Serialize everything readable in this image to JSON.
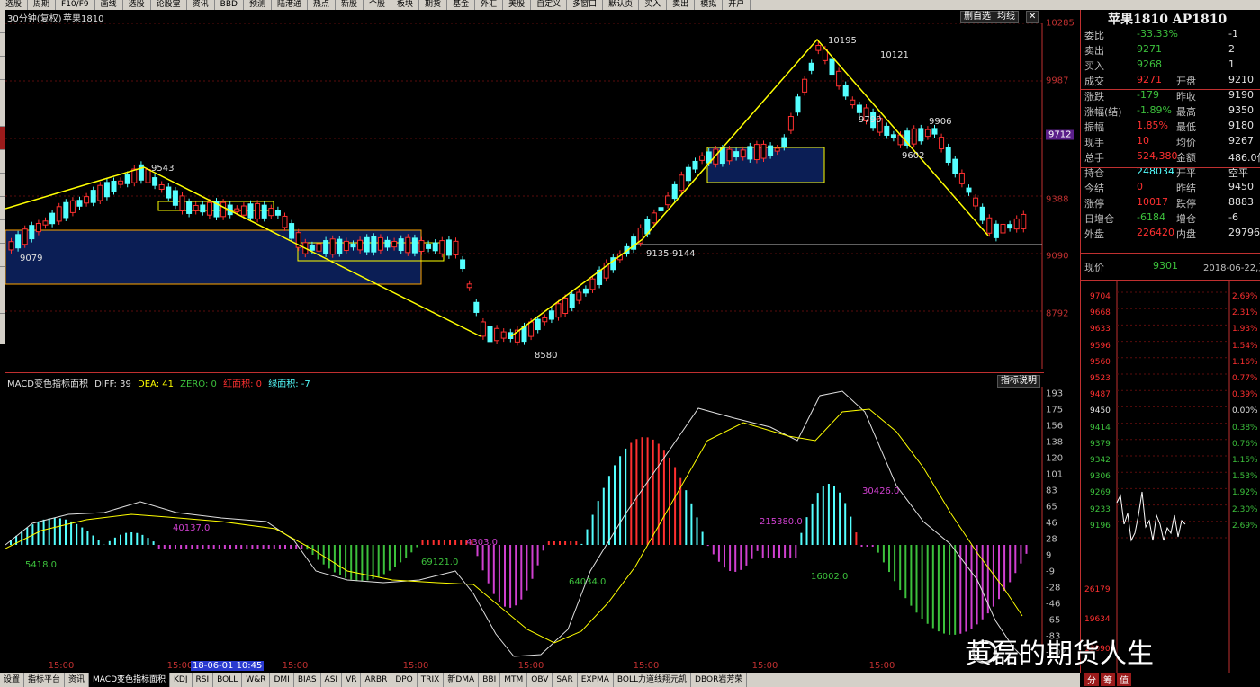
{
  "toolbar": {
    "items": [
      "选股",
      "周期",
      "F10/F9",
      "画线",
      "选股",
      "论股堂",
      "资讯",
      "BBD",
      "预测",
      "陆港通",
      "热点",
      "新股",
      "个股",
      "板块",
      "期货",
      "基金",
      "外汇",
      "美股",
      "自定义",
      "多窗口",
      "默认页",
      "买入",
      "卖出",
      "模拟",
      "开户"
    ]
  },
  "chart_header": {
    "period": "30分钟(复权)",
    "symbol": "苹果1810",
    "btn_delete": "删自选",
    "btn_avg": "均线"
  },
  "price_axis": {
    "ticks": [
      "10285",
      "9987",
      "9712",
      "9388",
      "9090",
      "8792"
    ],
    "current": "9712"
  },
  "annotations": {
    "high1": "9543",
    "low1": "9079",
    "low2": "8580",
    "high2": "10195",
    "high3": "10121",
    "mid1": "9790",
    "mid2": "9602",
    "mid3": "9906",
    "range": "9135-9144"
  },
  "macd_header": {
    "name": "MACD变色指标面积",
    "diff": "DIFF: 39",
    "dea": "DEA: 41",
    "zero": "ZERO: 0",
    "red_area": "红面积: 0",
    "green_area": "绿面积: -7",
    "explain": "指标说明"
  },
  "macd_axis": {
    "ticks": [
      "193",
      "175",
      "156",
      "138",
      "120",
      "101",
      "83",
      "65",
      "46",
      "28",
      "9",
      "-9",
      "-28",
      "-46",
      "-65",
      "-83",
      "-102"
    ]
  },
  "macd_labels": [
    "5418.0",
    "40137.0",
    "69121.0",
    "4303.0",
    "64034.0",
    "215380.0",
    "16002.0",
    "30426.0"
  ],
  "time_axis": {
    "labels": [
      "15:00",
      "15:00",
      "15:00",
      "15:00",
      "15:00",
      "15:00",
      "15:00",
      "15:00"
    ],
    "date_flag": "18-06-01 10:45"
  },
  "bottom_tabs": [
    "设置",
    "指标平台",
    "资讯",
    "MACD变色指标面积",
    "KDJ",
    "RSI",
    "BOLL",
    "W&R",
    "DMI",
    "BIAS",
    "ASI",
    "VR",
    "ARBR",
    "DPO",
    "TRIX",
    "新DMA",
    "BBI",
    "MTM",
    "OBV",
    "SAR",
    "EXPMA",
    "BOLL力道线翔元凯",
    "DBOR岩芳荣"
  ],
  "right_panel": {
    "title": "苹果1810 AP1810",
    "rows": [
      {
        "l1": "委比",
        "v1": "-33.33%",
        "l2": "",
        "v2": "-1"
      },
      {
        "l1": "卖出",
        "v1": "9271",
        "l2": "",
        "v2": "2"
      },
      {
        "l1": "买入",
        "v1": "9268",
        "l2": "",
        "v2": "1"
      },
      {
        "l1": "成交",
        "v1": "9271",
        "l2": "开盘",
        "v2": "9210"
      },
      {
        "l1": "涨跌",
        "v1": "-179",
        "l2": "昨收",
        "v2": "9190"
      },
      {
        "l1": "涨幅(结)",
        "v1": "-1.89%",
        "l2": "最高",
        "v2": "9350"
      },
      {
        "l1": "振幅",
        "v1": "1.85%",
        "l2": "最低",
        "v2": "9180"
      },
      {
        "l1": "现手",
        "v1": "10",
        "l2": "均价",
        "v2": "9267"
      },
      {
        "l1": "总手",
        "v1": "524,380",
        "l2": "金额",
        "v2": "486.0亿"
      },
      {
        "l1": "持仓",
        "v1": "248034",
        "l2": "开平",
        "v2": "空平"
      },
      {
        "l1": "今结",
        "v1": "0",
        "l2": "昨结",
        "v2": "9450"
      },
      {
        "l1": "涨停",
        "v1": "10017",
        "l2": "跌停",
        "v2": "8883"
      },
      {
        "l1": "日增仓",
        "v1": "-6184",
        "l2": "增仓",
        "v2": "-6"
      },
      {
        "l1": "外盘",
        "v1": "226420",
        "l2": "内盘",
        "v2": "297960"
      }
    ],
    "now_label": "现价",
    "now_value": "9301",
    "now_date": "2018-06-22,五",
    "mini_left": [
      "9704",
      "9668",
      "9633",
      "9596",
      "9560",
      "9523",
      "9487",
      "9450",
      "9414",
      "9379",
      "9342",
      "9306",
      "9269",
      "9233",
      "9196"
    ],
    "mini_right": [
      "2.69%",
      "2.31%",
      "1.93%",
      "1.54%",
      "1.16%",
      "0.77%",
      "0.39%",
      "0.00%",
      "0.38%",
      "0.76%",
      "1.15%",
      "1.53%",
      "1.92%",
      "2.30%",
      "2.69%"
    ],
    "vol_ticks": [
      "26179",
      "19634",
      "13090"
    ],
    "tabs": [
      "分",
      "筹",
      "值"
    ]
  },
  "watermark": "黄磊的期货人生",
  "colors": {
    "up": "#ff3030",
    "down": "#54ffff",
    "yellow": "#ffff00",
    "box": "#0b1e55",
    "axis": "#c03030"
  }
}
